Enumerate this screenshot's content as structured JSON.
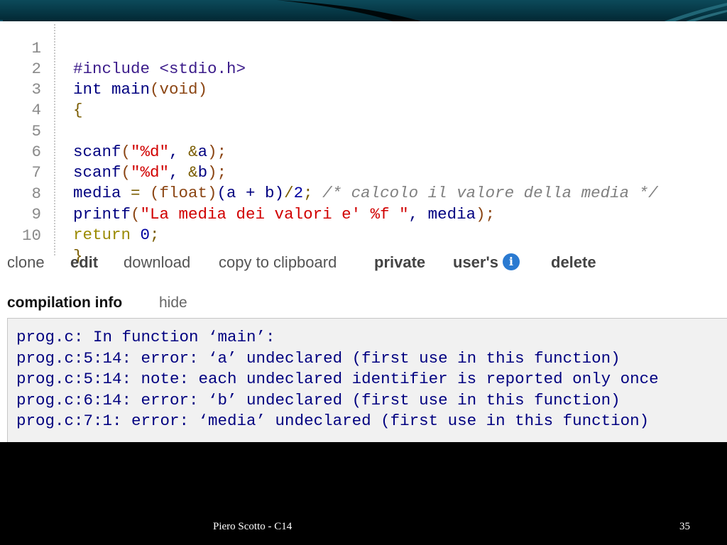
{
  "code": {
    "lines": [
      {
        "n": "1"
      },
      {
        "n": "2"
      },
      {
        "n": "3"
      },
      {
        "n": "4"
      },
      {
        "n": "5"
      },
      {
        "n": "6"
      },
      {
        "n": "7"
      },
      {
        "n": "8"
      },
      {
        "n": "9"
      },
      {
        "n": "10"
      }
    ],
    "l1": {
      "directive": "#include",
      "header": " <stdio.h>"
    },
    "l2": {
      "kw": "int",
      "name": " main",
      "open": "(",
      "param": "void",
      "close": ")"
    },
    "l3": {
      "brace": "{"
    },
    "l5": {
      "fn": "scanf",
      "open": "(",
      "fmt": "\"%d\"",
      "comma": ", ",
      "amp": "&",
      "var": "a",
      "close": ");"
    },
    "l6": {
      "fn": "scanf",
      "open": "(",
      "fmt": "\"%d\"",
      "comma": ", ",
      "amp": "&",
      "var": "b",
      "close": ");"
    },
    "l7": {
      "var": "media",
      "eq": " = ",
      "cast": "(float)",
      "expr": "(a + b)",
      "div": "/",
      "num": "2",
      "semi": "; ",
      "comment": "/* calcolo il valore della media */"
    },
    "l8": {
      "fn": "printf",
      "open": "(",
      "str": "\"La media dei valori e' %f \"",
      "comma": ", ",
      "var": "media",
      "close": ");"
    },
    "l9": {
      "kw": "return",
      "sp": " ",
      "num": "0",
      "semi": ";"
    },
    "l10": {
      "brace": "}"
    }
  },
  "actions": {
    "clone": "clone",
    "edit": "edit",
    "download": "download",
    "copy": "copy to clipboard",
    "private": "private",
    "users": "user's",
    "info_icon": "i",
    "delete": "delete"
  },
  "compilation": {
    "title": "compilation info",
    "hide": "hide",
    "output": [
      "prog.c: In function ‘main’:",
      "prog.c:5:14: error: ‘a’ undeclared (first use in this function)",
      "prog.c:5:14: note: each undeclared identifier is reported only once",
      "prog.c:6:14: error: ‘b’ undeclared (first use in this function)",
      "prog.c:7:1: error: ‘media’ undeclared (first use in this function)"
    ]
  },
  "footer": {
    "author": "Piero Scotto -  C14",
    "page": "35"
  },
  "colors": {
    "header_band": "#063644",
    "keyword": "#000080",
    "string": "#d10000",
    "comment": "#808080",
    "info_icon": "#2a7ad1"
  }
}
